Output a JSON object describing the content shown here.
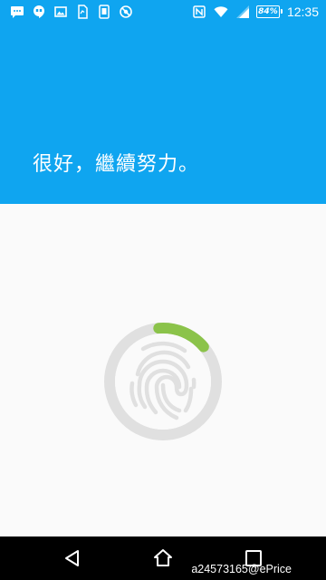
{
  "status_bar": {
    "time": "12:35",
    "battery_percent": "84%",
    "notification_icons": [
      "chat-icon",
      "hangouts-icon",
      "image-icon",
      "sim-icon",
      "app-icon",
      "no-disturb-icon"
    ],
    "system_icons": [
      "nfc-icon",
      "wifi-icon",
      "signal-icon",
      "battery-icon"
    ]
  },
  "header": {
    "title": "很好，繼續努力。",
    "background_color": "#0FA5F0"
  },
  "fingerprint": {
    "progress_fraction": 0.15,
    "accent_color": "#8BC34A",
    "ring_color": "#E0E0E0"
  },
  "navbar": {
    "buttons": [
      "back-icon",
      "home-icon",
      "recents-icon"
    ],
    "watermark": "a24573165@ePrice"
  }
}
